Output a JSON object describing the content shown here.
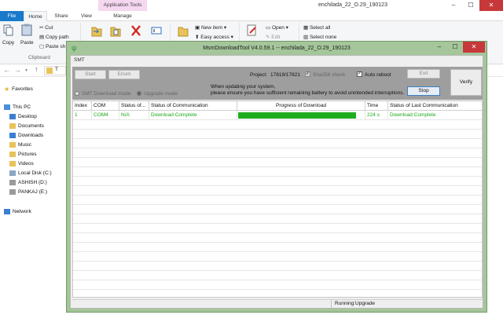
{
  "explorer": {
    "app_tools_label": "Application Tools",
    "window_title": "enchilada_22_O.29_190123",
    "tabs": {
      "file": "File",
      "home": "Home",
      "share": "Share",
      "view": "View",
      "manage": "Manage"
    },
    "ribbon": {
      "copy": "Copy",
      "paste": "Paste",
      "cut": "Cut",
      "copy_path": "Copy path",
      "paste_shortcut": "Paste sh",
      "clipboard": "Clipboard",
      "new_item": "New item",
      "easy_access": "Easy access",
      "open": "Open",
      "edit": "Edit",
      "select_all": "Select all",
      "select_none": "Select none"
    },
    "nav": {
      "back_glyph": "←",
      "forward_glyph": "→",
      "up_glyph": "↑",
      "path_initial": "T"
    },
    "sidebar": {
      "favorites": "Favorites",
      "this_pc": "This PC",
      "items": [
        "Desktop",
        "Documents",
        "Downloads",
        "Music",
        "Pictures",
        "Videos",
        "Local Disk (C:)",
        "ASHISH (D:)",
        "PANKAJ (E:)"
      ],
      "network": "Network"
    }
  },
  "dialog": {
    "title": "MsmDownloadTool V4.0.59.1 -- enchilada_22_O.29_190123",
    "tab_label": "SMT",
    "buttons": {
      "start": "Start",
      "enum": "Enum",
      "exit": "Exit",
      "stop": "Stop",
      "verify": "Verify"
    },
    "project_label": "Project:",
    "project_value": "17819/17821",
    "sha256_label": "Sha256 check",
    "auto_reboot_label": "Auto reboot",
    "modes": {
      "smt": "SMT Download mode",
      "upgrade": "Upgrade mode"
    },
    "warning_line1": "When updating your system,",
    "warning_line2": "please ensure you have sufficient remaining battery to avoid unintended interruptions.",
    "table": {
      "headers": {
        "index": "Index",
        "com": "COM",
        "status_of": "Status of...",
        "comm": "Status of Communication",
        "progress": "Progress of Download",
        "time": "Time",
        "last": "Status of Last Communication"
      },
      "rows": [
        {
          "index": "1",
          "com": "COM4",
          "status": "N/A",
          "comm": "Download Complete",
          "progress": 1.0,
          "time": "224 s",
          "last": "Download Complete"
        }
      ]
    },
    "status_text": "Running:Upgrade"
  },
  "colors": {
    "progress": "#1fad1f",
    "row_text": "#1aa81a",
    "dialog_frame": "#a4c69a",
    "file_tab": "#1979ca"
  }
}
